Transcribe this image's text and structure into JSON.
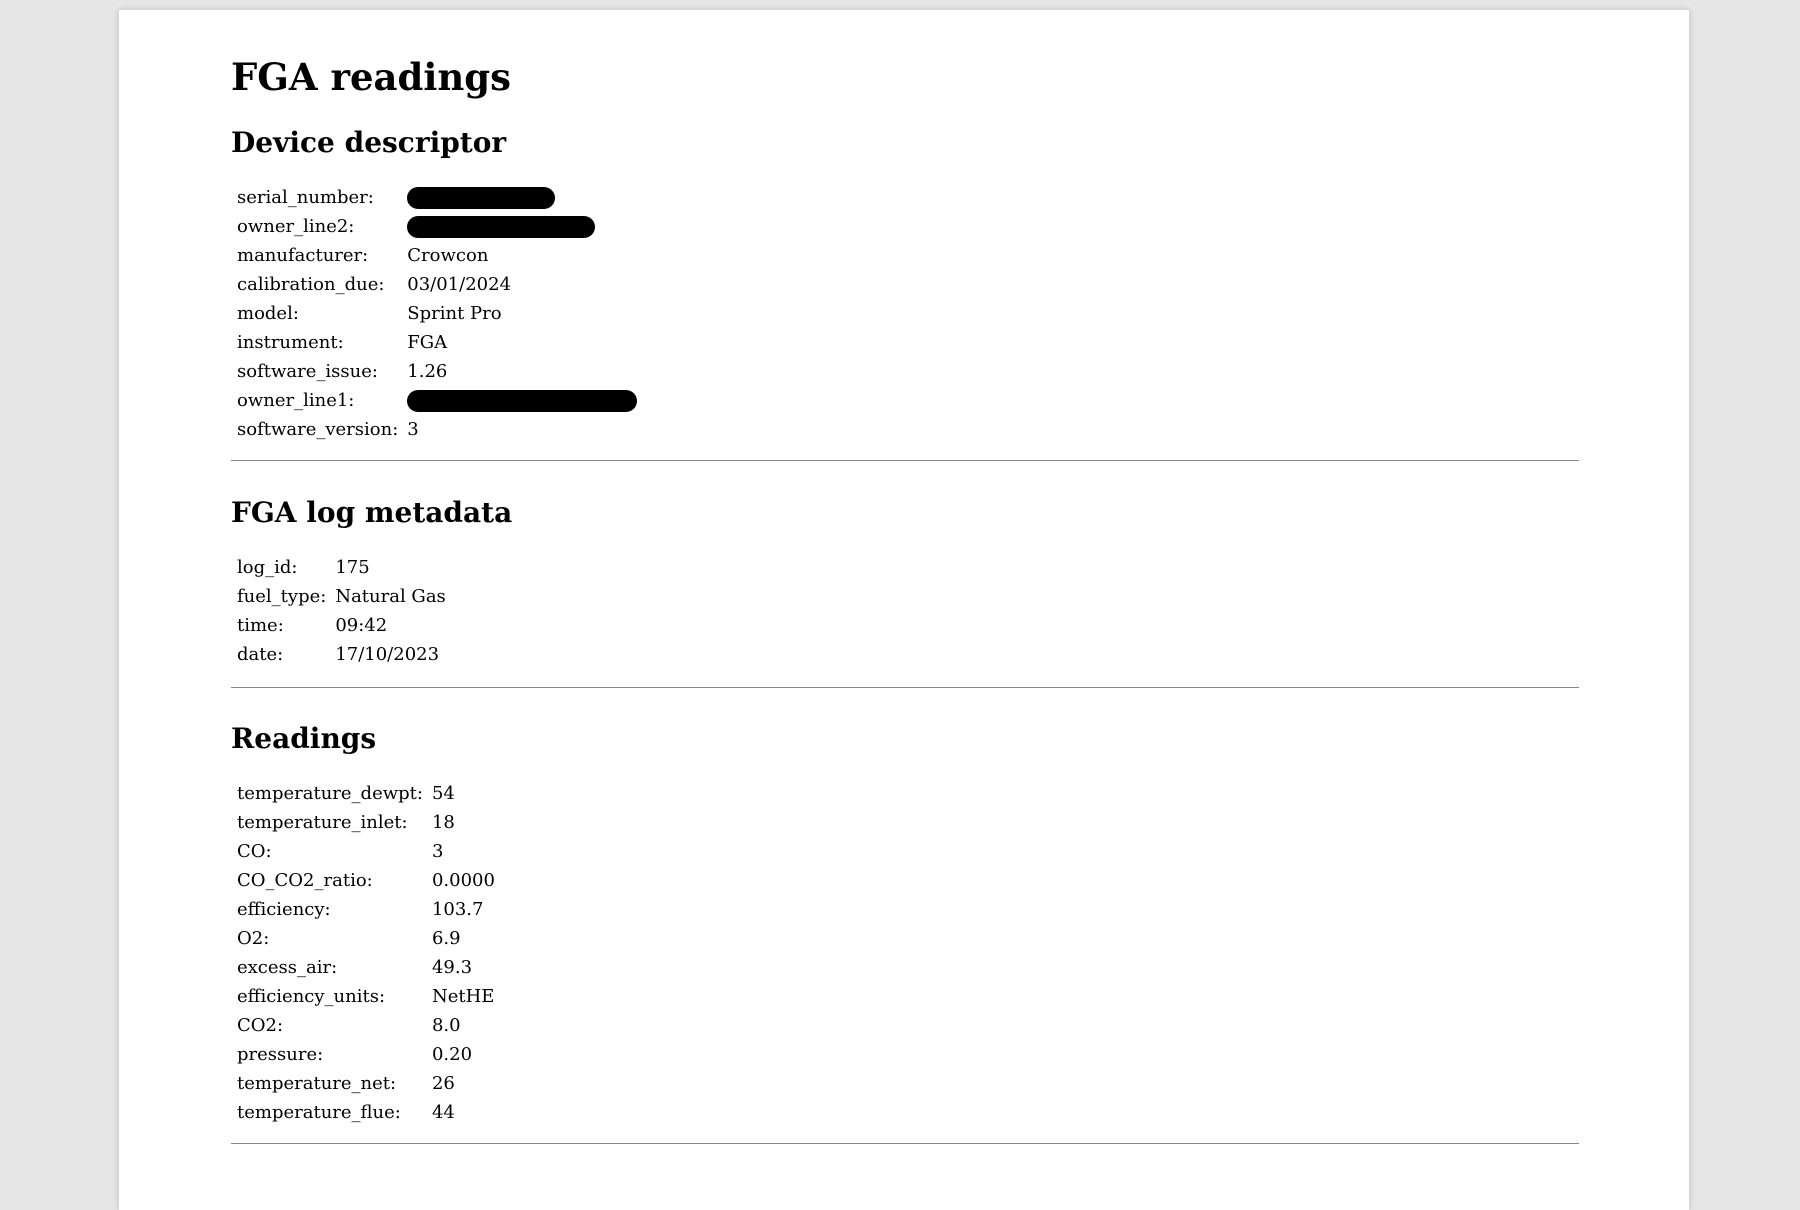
{
  "page": {
    "title": "FGA readings"
  },
  "device": {
    "heading": "Device descriptor",
    "rows": [
      {
        "key": "serial_number:",
        "value": "",
        "redacted": true
      },
      {
        "key": "owner_line2:",
        "value": "",
        "redacted": true
      },
      {
        "key": "manufacturer:",
        "value": "Crowcon",
        "redacted": false
      },
      {
        "key": "calibration_due:",
        "value": "03/01/2024",
        "redacted": false
      },
      {
        "key": "model:",
        "value": "Sprint Pro",
        "redacted": false
      },
      {
        "key": "instrument:",
        "value": "FGA",
        "redacted": false
      },
      {
        "key": "software_issue:",
        "value": "1.26",
        "redacted": false
      },
      {
        "key": "owner_line1:",
        "value": "",
        "redacted": true
      },
      {
        "key": "software_version:",
        "value": "3",
        "redacted": false
      }
    ]
  },
  "log": {
    "heading": "FGA log metadata",
    "rows": [
      {
        "key": "log_id:",
        "value": "175"
      },
      {
        "key": "fuel_type:",
        "value": "Natural Gas"
      },
      {
        "key": "time:",
        "value": "09:42"
      },
      {
        "key": "date:",
        "value": "17/10/2023"
      }
    ]
  },
  "readings": {
    "heading": "Readings",
    "rows": [
      {
        "key": "temperature_dewpt:",
        "value": "54"
      },
      {
        "key": "temperature_inlet:",
        "value": "18"
      },
      {
        "key": "CO:",
        "value": "3"
      },
      {
        "key": "CO_CO2_ratio:",
        "value": "0.0000"
      },
      {
        "key": "efficiency:",
        "value": "103.7"
      },
      {
        "key": "O2:",
        "value": "6.9"
      },
      {
        "key": "excess_air:",
        "value": "49.3"
      },
      {
        "key": "efficiency_units:",
        "value": "NetHE"
      },
      {
        "key": "CO2:",
        "value": "8.0"
      },
      {
        "key": "pressure:",
        "value": "0.20"
      },
      {
        "key": "temperature_net:",
        "value": "26"
      },
      {
        "key": "temperature_flue:",
        "value": "44"
      }
    ]
  }
}
